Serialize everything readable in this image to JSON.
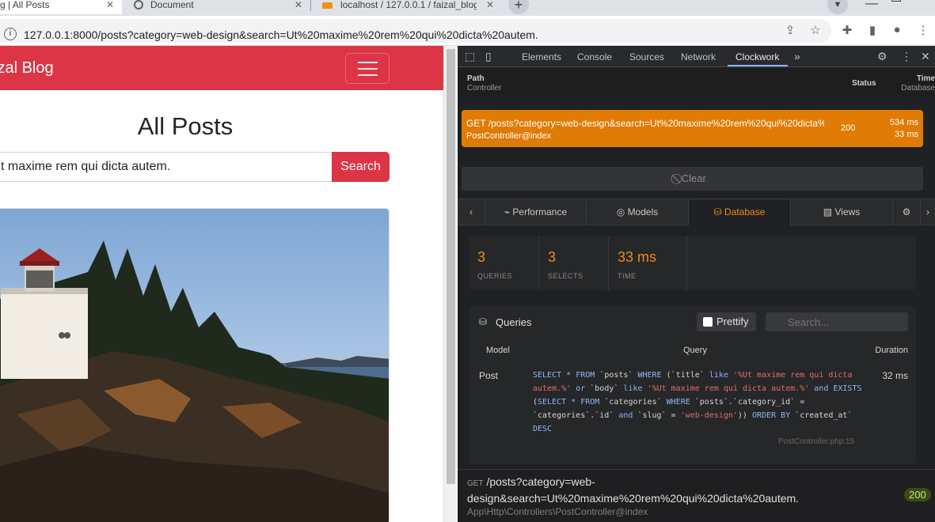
{
  "browser": {
    "tabs": [
      {
        "title": "g | All Posts",
        "active": true
      },
      {
        "title": "Document",
        "active": false
      },
      {
        "title": "localhost / 127.0.0.1 / faizal_blog",
        "active": false
      }
    ],
    "url": "127.0.0.1:8000/posts?category=web-design&search=Ut%20maxime%20rem%20qui%20dicta%20autem."
  },
  "page": {
    "brand": "izal Blog",
    "heading": "All Posts",
    "search_value": "t maxime rem qui dicta autem.",
    "search_button": "Search"
  },
  "devtools": {
    "tabs": [
      "Elements",
      "Console",
      "Sources",
      "Network",
      "Clockwork"
    ],
    "active_tab": "Clockwork",
    "header": {
      "path": "Path",
      "controller": "Controller",
      "status": "Status",
      "time": "Time",
      "database": "Database"
    },
    "request": {
      "path": "GET /posts?category=web-design&search=Ut%20maxime%20rem%20qui%20dicta%20autem.",
      "controller": "PostController@index",
      "status": "200",
      "time": "534 ms",
      "db_time": "33 ms"
    },
    "clear_label": "Clear",
    "subtabs": [
      "Performance",
      "Models",
      "Database",
      "Views"
    ],
    "active_subtab": "Database",
    "stats": [
      {
        "value": "3",
        "label": "QUERIES"
      },
      {
        "value": "3",
        "label": "SELECTS"
      },
      {
        "value": "33 ms",
        "label": "TIME"
      }
    ],
    "queries": {
      "title": "Queries",
      "prettify_label": "Prettify",
      "search_placeholder": "Search...",
      "columns": [
        "Model",
        "Query",
        "Duration"
      ],
      "rows": [
        {
          "model": "Post",
          "duration": "32 ms",
          "file": "PostController.php:15"
        }
      ]
    },
    "footer": {
      "method": "GET",
      "path": "/posts?category=web-design&search=Ut%20maxime%20rem%20qui%20dicta%20autem.",
      "status": "200",
      "controller": "App\\Http\\Controllers\\PostController@index"
    }
  },
  "colors": {
    "navbar": "#dc3545",
    "clockwork_accent": "#e07b06",
    "devtools_bg": "#202124"
  }
}
